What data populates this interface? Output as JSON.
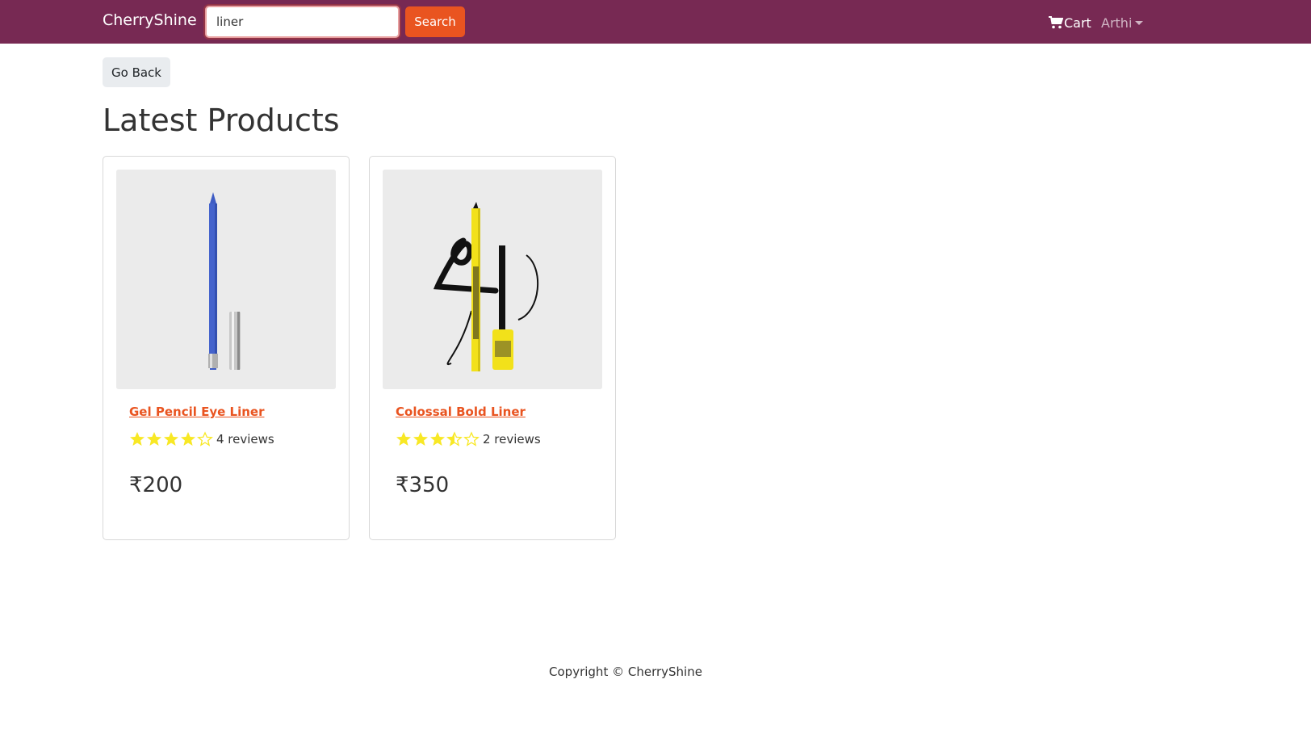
{
  "header": {
    "brand": "CherryShine",
    "search_value": "liner",
    "search_button": "Search",
    "cart_label": "Cart",
    "user_name": "Arthi",
    "colors": {
      "navbar": "#772953",
      "accent": "#e95420"
    }
  },
  "main": {
    "go_back_label": "Go Back",
    "title": "Latest Products",
    "products": [
      {
        "name": "Gel Pencil Eye Liner",
        "rating": 4,
        "reviews": "4 reviews",
        "price": "₹200",
        "image_icon": "blue-eye-pencil-icon"
      },
      {
        "name": "Colossal Bold Liner",
        "rating": 3.5,
        "reviews": "2 reviews",
        "price": "₹350",
        "image_icon": "yellow-eyeliner-set-icon"
      }
    ]
  },
  "footer": {
    "copyright": "Copyright © CherryShine"
  },
  "colors": {
    "star": "#f8e825",
    "link": "#e95420"
  }
}
